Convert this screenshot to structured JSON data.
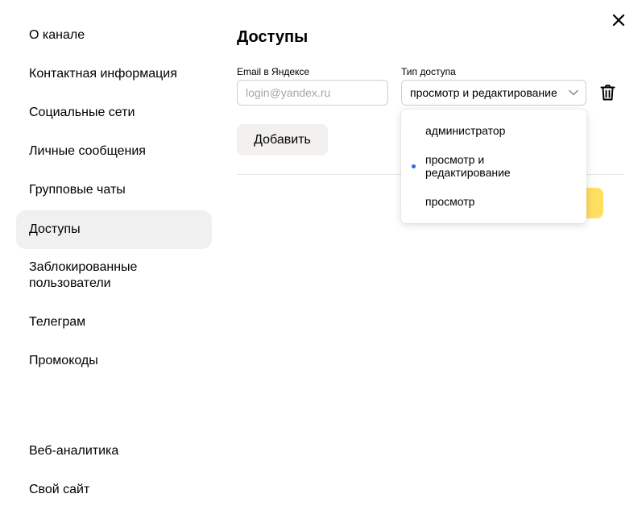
{
  "sidebar": {
    "items": [
      {
        "label": "О канале"
      },
      {
        "label": "Контактная информация"
      },
      {
        "label": "Социальные сети"
      },
      {
        "label": "Личные сообщения"
      },
      {
        "label": "Групповые чаты"
      },
      {
        "label": "Доступы",
        "active": true
      },
      {
        "label": "Заблокированные пользователи"
      },
      {
        "label": "Телеграм"
      },
      {
        "label": "Промокоды"
      },
      {
        "label": "Веб-аналитика"
      },
      {
        "label": "Свой сайт"
      }
    ]
  },
  "main": {
    "title": "Доступы",
    "email_label": "Email в Яндексе",
    "email_placeholder": "login@yandex.ru",
    "email_value": "",
    "access_label": "Тип доступа",
    "access_selected": "просмотр и редактирование",
    "add_button": "Добавить"
  },
  "dropdown": {
    "options": [
      {
        "label": "администратор"
      },
      {
        "label": "просмотр и редактирование",
        "selected": true
      },
      {
        "label": "просмотр"
      }
    ]
  },
  "icons": {
    "close": "close-icon",
    "chevron": "chevron-down-icon",
    "trash": "trash-icon"
  },
  "colors": {
    "active_item_bg": "#f0f0f0",
    "add_button_bg": "#f2f1ef",
    "primary_button_bg": "#ffdf60",
    "selected_dot": "#2a6fd6"
  }
}
